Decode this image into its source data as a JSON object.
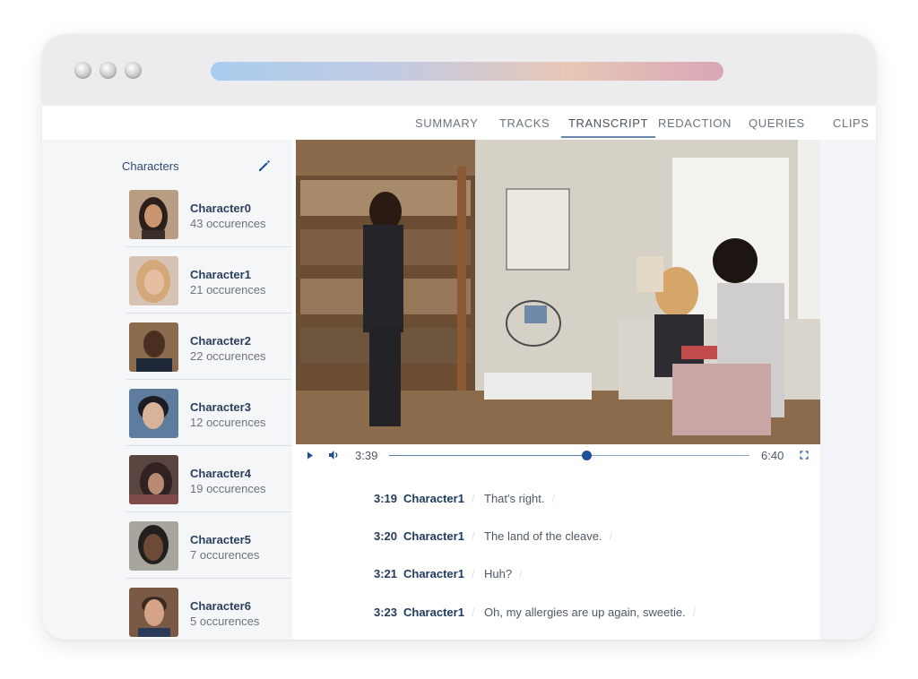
{
  "nav": {
    "tabs": [
      {
        "label": "SUMMARY"
      },
      {
        "label": "TRACKS"
      },
      {
        "label": "TRANSCRIPT"
      },
      {
        "label": "REDACTION"
      },
      {
        "label": "QUERIES"
      },
      {
        "label": "CLIPS"
      }
    ],
    "active_tab": "TRANSCRIPT"
  },
  "sidebar": {
    "title": "Characters",
    "edit_icon": "pencil-icon",
    "characters": [
      {
        "name": "Character0",
        "count": "43 occurences"
      },
      {
        "name": "Character1",
        "count": "21 occurences"
      },
      {
        "name": "Character2",
        "count": "22 occurences"
      },
      {
        "name": "Character3",
        "count": "12 occurences"
      },
      {
        "name": "Character4",
        "count": "19 occurences"
      },
      {
        "name": "Character5",
        "count": "7 occurences"
      },
      {
        "name": "Character6",
        "count": "5 occurences"
      }
    ]
  },
  "player": {
    "current_time": "3:39",
    "duration": "6:40",
    "progress": 0.5475,
    "icons": [
      "play-icon",
      "volume-icon",
      "fullscreen-icon"
    ]
  },
  "transcript": [
    {
      "time": "3:19",
      "speaker": "Character1",
      "text": "That's right."
    },
    {
      "time": "3:20",
      "speaker": "Character1",
      "text": "The land of the cleave."
    },
    {
      "time": "3:21",
      "speaker": "Character1",
      "text": "Huh?"
    },
    {
      "time": "3:23",
      "speaker": "Character1",
      "text": "Oh, my allergies are up again, sweetie."
    }
  ],
  "colors": {
    "accent": "#1f4f94",
    "speaker": "#1f3a60",
    "tab_underline": "#6a86ad"
  }
}
